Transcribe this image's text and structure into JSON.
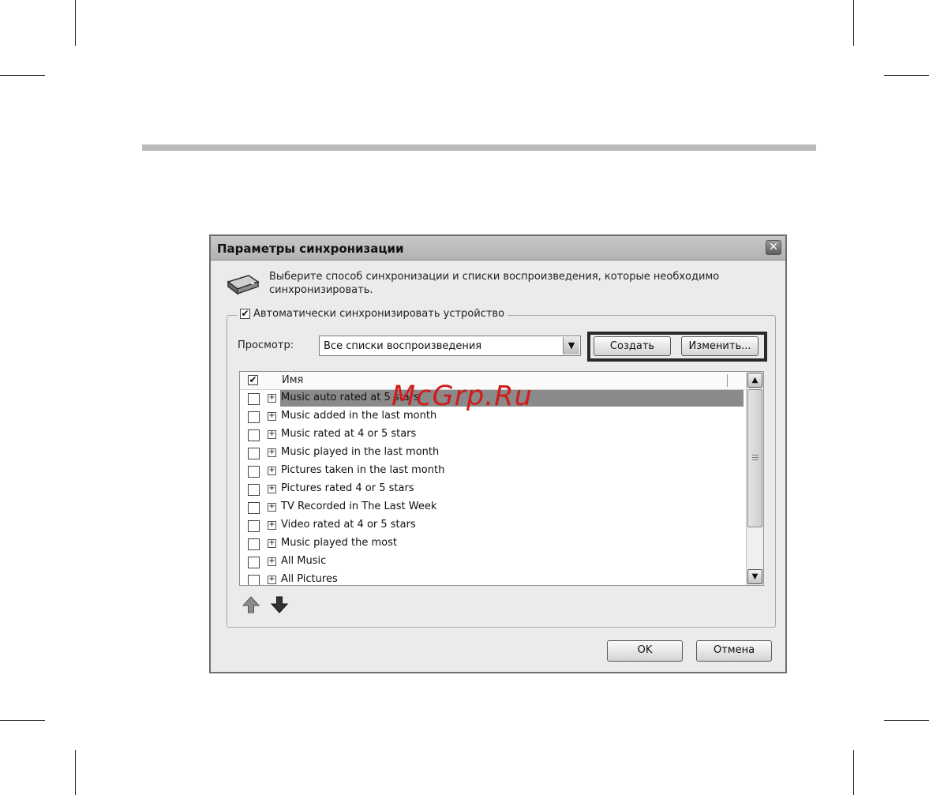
{
  "dialog": {
    "title": "Параметры синхронизации",
    "close_glyph": "✕",
    "intro": "Выберите способ синхронизации и списки воспроизведения, которые необходимо синхронизировать.",
    "auto_sync_label": "Автоматически синхронизировать устройство",
    "auto_sync_checked": true,
    "view_label": "Просмотр:",
    "view_select": {
      "value": "Все списки воспроизведения",
      "arrow_glyph": "▼"
    },
    "create_button": "Создать",
    "edit_button": "Изменить...",
    "list": {
      "header_name": "Имя",
      "header_checked": true,
      "rows": [
        {
          "label": "Music auto rated at 5 stars",
          "checked": false,
          "selected": true
        },
        {
          "label": "Music added in the last month",
          "checked": false
        },
        {
          "label": "Music rated at 4 or 5 stars",
          "checked": false
        },
        {
          "label": "Music played in the last month",
          "checked": false
        },
        {
          "label": "Pictures taken in the last month",
          "checked": false
        },
        {
          "label": "Pictures rated 4 or 5 stars",
          "checked": false
        },
        {
          "label": "TV Recorded in The Last Week",
          "checked": false
        },
        {
          "label": "Video rated at 4 or 5 stars",
          "checked": false
        },
        {
          "label": "Music played the most",
          "checked": false
        },
        {
          "label": "All Music",
          "checked": false
        },
        {
          "label": "All Pictures",
          "checked": false
        }
      ],
      "expander_glyph": "+",
      "check_glyph": "✔",
      "scroll_up_glyph": "▲",
      "scroll_down_glyph": "▼"
    },
    "ok_button": "OK",
    "cancel_button": "Отмена"
  },
  "icons": {
    "device": "device-icon",
    "move_up": "arrow-up-icon",
    "move_down": "arrow-down-icon"
  },
  "watermark": "McGrp.Ru"
}
